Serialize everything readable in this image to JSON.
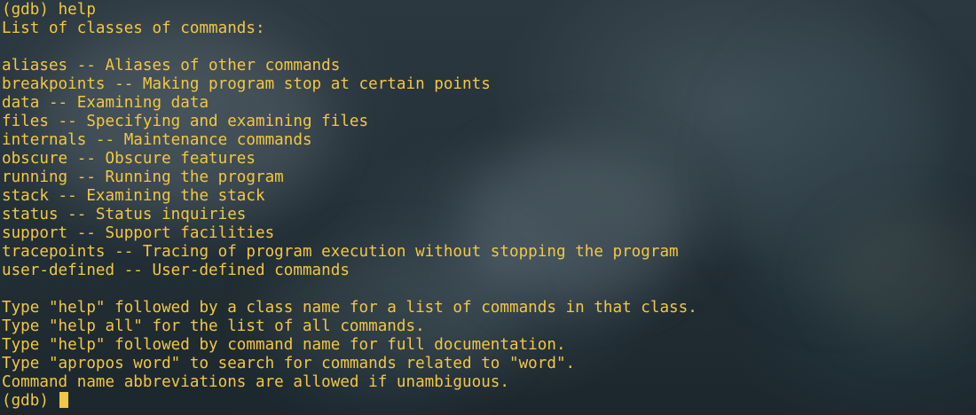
{
  "terminal": {
    "prompt": "(gdb) ",
    "command": "help",
    "lines": [
      "List of classes of commands:",
      "",
      "aliases -- Aliases of other commands",
      "breakpoints -- Making program stop at certain points",
      "data -- Examining data",
      "files -- Specifying and examining files",
      "internals -- Maintenance commands",
      "obscure -- Obscure features",
      "running -- Running the program",
      "stack -- Examining the stack",
      "status -- Status inquiries",
      "support -- Support facilities",
      "tracepoints -- Tracing of program execution without stopping the program",
      "user-defined -- User-defined commands",
      "",
      "Type \"help\" followed by a class name for a list of commands in that class.",
      "Type \"help all\" for the list of all commands.",
      "Type \"help\" followed by command name for full documentation.",
      "Type \"apropos word\" to search for commands related to \"word\".",
      "Command name abbreviations are allowed if unambiguous."
    ],
    "final_prompt": "(gdb) "
  },
  "colors": {
    "text": "#f2c744",
    "background": "#1f2a30"
  }
}
